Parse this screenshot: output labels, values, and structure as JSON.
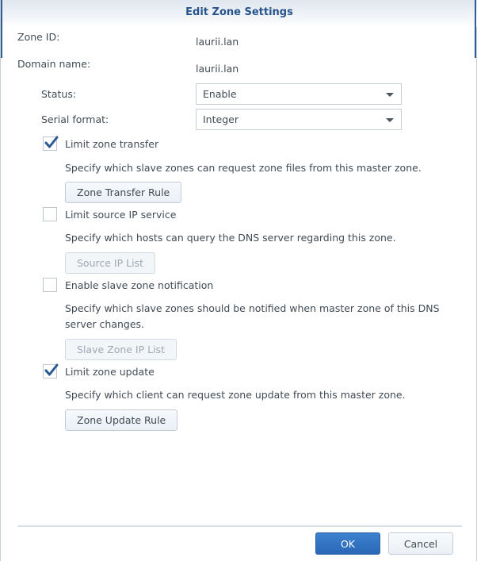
{
  "dialog": {
    "title": "Edit Zone Settings"
  },
  "fields": {
    "zone_id": {
      "label": "Zone ID:",
      "value": "laurii.lan"
    },
    "domain_name": {
      "label": "Domain name:",
      "value": "laurii.lan"
    },
    "status": {
      "label": "Status:",
      "selected": "Enable"
    },
    "serial_format": {
      "label": "Serial format:",
      "selected": "Integer"
    }
  },
  "options": [
    {
      "label": "Limit zone transfer",
      "checked": true,
      "description": "Specify which slave zones can request zone files from this master zone.",
      "button_label": "Zone Transfer Rule",
      "button_enabled": true
    },
    {
      "label": "Limit source IP service",
      "checked": false,
      "description": "Specify which hosts can query the DNS server regarding this zone.",
      "button_label": "Source IP List",
      "button_enabled": false
    },
    {
      "label": "Enable slave zone notification",
      "checked": false,
      "description": "Specify which slave zones should be notified when master zone of this DNS server changes.",
      "button_label": "Slave Zone IP List",
      "button_enabled": false
    },
    {
      "label": "Limit zone update",
      "checked": true,
      "description": "Specify which client can request zone update from this master zone.",
      "button_label": "Zone Update Rule",
      "button_enabled": true
    }
  ],
  "footer": {
    "ok_label": "OK",
    "cancel_label": "Cancel"
  },
  "colors": {
    "title": "#26548a",
    "primary_button": "#2a67b5",
    "checkmark": "#2b5a92"
  }
}
